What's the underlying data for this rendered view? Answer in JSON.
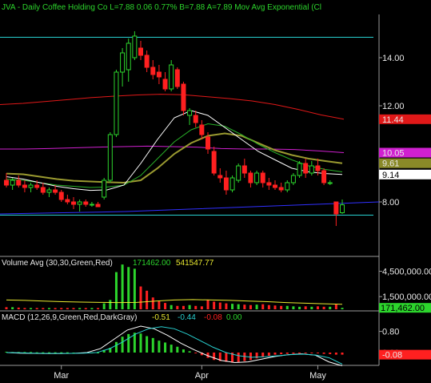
{
  "header": {
    "text": "JVA - Daily  Coffee Holding Co  L=7.88  0.06  0.77%  B=7.88  A=7.89  Mov Avg Exponential (Cl"
  },
  "colors": {
    "background": "#000000",
    "up_candle": "#2cd42c",
    "down_candle": "#ff2020",
    "header_text": "#2cd42c",
    "axis_text": "#e8e8e8",
    "bollinger_bands": "#28d0d0",
    "ma_long_red": "#e01818",
    "ma_magenta": "#d020d0",
    "ma_olive": "#9a9a30",
    "ma_green": "#28b028",
    "ma_white": "#ffffff",
    "blue_line": "#3030ff",
    "volume_avg": "#e8e830",
    "macd_line": "#ffffff",
    "macd_signal": "#28d0d0"
  },
  "chart_data": [
    {
      "type": "candlestick",
      "panel": "price",
      "x": [
        "2/15",
        "2/16",
        "2/17",
        "2/21",
        "2/22",
        "2/23",
        "2/24",
        "2/27",
        "2/28",
        "3/1",
        "3/2",
        "3/3",
        "3/6",
        "3/7",
        "3/8",
        "3/9",
        "3/10",
        "3/13",
        "3/14",
        "3/15",
        "3/16",
        "3/17",
        "3/20",
        "3/21",
        "3/22",
        "3/23",
        "3/24",
        "3/27",
        "3/28",
        "3/29",
        "3/30",
        "3/31",
        "4/3",
        "4/4",
        "4/5",
        "4/6",
        "4/7",
        "4/10",
        "4/11",
        "4/12",
        "4/13",
        "4/17",
        "4/18",
        "4/19",
        "4/20",
        "4/21",
        "4/24",
        "4/25",
        "4/26",
        "4/27",
        "4/28",
        "5/1",
        "5/2",
        "5/3",
        "5/4",
        "5/5"
      ],
      "x_tick_labels": [
        "Mar",
        "Apr",
        "May"
      ],
      "y_tick_labels": [
        "14.00",
        "12.00",
        "10.00",
        "8.00"
      ],
      "y_axis_side": "right",
      "ylim": [
        6.5,
        15.2
      ],
      "last_values": {
        "ma_red": "11.44",
        "ma_magenta": "10.05",
        "ma_olive": "9.61",
        "ma_white": "9.14"
      },
      "series": [
        {
          "kind": "ohlc",
          "values": [
            [
              8.9,
              9.2,
              8.6,
              8.7
            ],
            [
              8.7,
              9.0,
              8.5,
              8.9
            ],
            [
              8.9,
              9.1,
              8.6,
              8.7
            ],
            [
              8.7,
              8.9,
              8.4,
              8.6
            ],
            [
              8.6,
              8.8,
              8.4,
              8.7
            ],
            [
              8.7,
              8.9,
              8.5,
              8.6
            ],
            [
              8.6,
              8.8,
              8.3,
              8.4
            ],
            [
              8.4,
              8.6,
              8.2,
              8.5
            ],
            [
              8.5,
              8.7,
              8.3,
              8.4
            ],
            [
              8.4,
              8.5,
              8.0,
              8.1
            ],
            [
              8.1,
              8.3,
              7.9,
              8.0
            ],
            [
              8.0,
              8.2,
              7.7,
              7.9
            ],
            [
              7.9,
              8.1,
              7.6,
              8.0
            ],
            [
              8.0,
              8.1,
              7.8,
              7.9
            ],
            [
              7.9,
              8.0,
              7.8,
              7.9
            ],
            [
              7.9,
              8.0,
              7.8,
              7.8
            ],
            [
              8.2,
              9.0,
              8.1,
              8.9
            ],
            [
              8.9,
              10.9,
              8.8,
              10.8
            ],
            [
              10.8,
              13.5,
              10.7,
              13.4
            ],
            [
              13.4,
              14.4,
              12.8,
              14.2
            ],
            [
              13.5,
              14.8,
              13.0,
              14.6
            ],
            [
              14.0,
              15.1,
              13.9,
              14.9
            ],
            [
              14.4,
              14.7,
              13.9,
              14.1
            ],
            [
              14.1,
              14.3,
              13.4,
              13.6
            ],
            [
              13.6,
              13.9,
              13.1,
              13.3
            ],
            [
              13.4,
              13.7,
              12.9,
              13.2
            ],
            [
              13.1,
              13.4,
              12.6,
              12.7
            ],
            [
              12.7,
              13.9,
              12.6,
              13.7
            ],
            [
              13.5,
              13.6,
              12.7,
              12.8
            ],
            [
              12.9,
              13.0,
              11.6,
              11.8
            ],
            [
              11.6,
              11.9,
              11.2,
              11.8
            ],
            [
              11.6,
              11.8,
              11.1,
              11.3
            ],
            [
              11.2,
              11.4,
              10.6,
              10.8
            ],
            [
              10.7,
              10.9,
              10.0,
              10.2
            ],
            [
              10.1,
              10.3,
              9.1,
              9.2
            ],
            [
              9.1,
              9.4,
              8.8,
              9.0
            ],
            [
              9.0,
              9.3,
              8.3,
              8.5
            ],
            [
              8.5,
              9.1,
              8.4,
              9.0
            ],
            [
              8.9,
              9.6,
              8.8,
              9.5
            ],
            [
              9.5,
              9.8,
              9.0,
              9.2
            ],
            [
              9.2,
              9.3,
              8.6,
              8.8
            ],
            [
              8.8,
              9.3,
              8.7,
              9.2
            ],
            [
              9.2,
              9.3,
              8.6,
              8.8
            ],
            [
              8.8,
              9.0,
              8.5,
              8.7
            ],
            [
              8.7,
              8.9,
              8.5,
              8.6
            ],
            [
              8.6,
              8.8,
              8.4,
              8.5
            ],
            [
              8.5,
              8.9,
              8.4,
              8.8
            ],
            [
              8.8,
              9.2,
              8.7,
              9.1
            ],
            [
              9.1,
              9.7,
              9.0,
              9.6
            ],
            [
              9.6,
              9.8,
              9.0,
              9.2
            ],
            [
              9.2,
              9.7,
              9.1,
              9.5
            ],
            [
              9.5,
              9.8,
              9.1,
              9.3
            ],
            [
              9.3,
              9.4,
              8.7,
              8.8
            ],
            [
              8.8,
              8.9,
              8.7,
              8.8
            ],
            [
              8.0,
              8.0,
              7.0,
              7.5
            ],
            [
              7.55,
              8.1,
              7.5,
              7.88
            ]
          ]
        },
        {
          "kind": "line",
          "name": "bb_upper",
          "values": [
            14.85,
            14.85
          ]
        },
        {
          "kind": "line",
          "name": "bb_lower",
          "values": [
            7.45,
            7.45
          ]
        },
        {
          "kind": "line",
          "name": "ma_red",
          "values": [
            12.05,
            12.1,
            12.18,
            12.26,
            12.34,
            12.4,
            12.45,
            12.48,
            12.46,
            12.38,
            12.3,
            12.2,
            12.05,
            11.85,
            11.62,
            11.44
          ]
        },
        {
          "kind": "line",
          "name": "ma_magenta",
          "values": [
            10.2,
            10.2,
            10.22,
            10.25,
            10.28,
            10.3,
            10.32,
            10.3,
            10.28,
            10.22,
            10.2,
            10.2,
            10.18,
            10.12,
            10.05
          ]
        },
        {
          "kind": "line",
          "name": "ma_olive",
          "values": [
            9.18,
            9.15,
            9.05,
            8.95,
            8.88,
            8.85,
            8.82,
            8.8,
            8.9,
            9.4,
            10.0,
            10.45,
            10.75,
            10.85,
            10.75,
            10.45,
            10.15,
            9.95,
            9.8,
            9.7,
            9.61
          ]
        },
        {
          "kind": "line",
          "name": "ma_green",
          "values": [
            8.95,
            8.9,
            8.8,
            8.7,
            8.65,
            8.6,
            8.62,
            8.7,
            9.1,
            9.8,
            10.5,
            11.0,
            11.25,
            11.15,
            10.8,
            10.4,
            10.05,
            9.75,
            9.5,
            9.35,
            9.25
          ]
        },
        {
          "kind": "line",
          "name": "ma_white",
          "values": [
            9.05,
            8.95,
            8.8,
            8.65,
            8.55,
            8.48,
            8.5,
            8.7,
            9.6,
            10.6,
            11.5,
            11.8,
            11.6,
            11.1,
            10.6,
            10.1,
            9.75,
            9.4,
            9.25,
            9.18,
            9.14
          ]
        },
        {
          "kind": "line",
          "name": "blue_line",
          "values": [
            7.5,
            7.55,
            7.6,
            7.7,
            7.8,
            7.9,
            8.0
          ]
        }
      ]
    },
    {
      "type": "bar",
      "panel": "volume",
      "title": "Volume Avg (30,30,Green,Red)",
      "values_text": [
        "171462.00",
        "541547.77"
      ],
      "y_tick_labels": [
        "4,500,000.00",
        "1,500,000.00"
      ],
      "last_value": "171,462.00",
      "ylim": [
        0,
        5500000
      ],
      "values": [
        250000,
        250000,
        200000,
        150000,
        150000,
        150000,
        150000,
        150000,
        150000,
        150000,
        150000,
        150000,
        150000,
        150000,
        150000,
        150000,
        700000,
        1100000,
        4400000,
        5300000,
        5000000,
        4800000,
        2700000,
        2200000,
        1400000,
        950000,
        750000,
        500000,
        400000,
        400000,
        500000,
        400000,
        350000,
        1100000,
        900000,
        800000,
        700000,
        650000,
        600000,
        550000,
        500000,
        550000,
        600000,
        500000,
        450000,
        400000,
        400000,
        350000,
        300000,
        350000,
        300000,
        350000,
        300000,
        300000,
        600000,
        171462
      ],
      "ma_values": [
        1100000,
        1050000,
        980000,
        900000,
        850000,
        820000,
        800000,
        820000,
        980000,
        1100000,
        1150000,
        1100000,
        1050000,
        980000,
        900000,
        800000,
        720000,
        650000,
        600000
      ]
    },
    {
      "type": "bar",
      "panel": "macd",
      "title": "MACD (12,26,9,Green,Red,DarkGray)",
      "values_text": [
        "-0.51",
        "-0.44",
        "-0.08",
        "0.00"
      ],
      "y_tick_labels": [
        "0.80",
        "0.00"
      ],
      "last_value": "-0.08",
      "ylim": [
        -0.55,
        1.15
      ],
      "histogram": [
        0.03,
        0.02,
        0.02,
        0.02,
        0.02,
        0.01,
        0.01,
        0.01,
        0.01,
        0.01,
        0.01,
        0.0,
        0.0,
        0.0,
        0.0,
        0.0,
        0.1,
        0.18,
        0.4,
        0.6,
        0.7,
        0.75,
        0.72,
        0.62,
        0.55,
        0.45,
        0.38,
        0.3,
        0.22,
        0.12,
        0.05,
        -0.03,
        -0.1,
        -0.2,
        -0.28,
        -0.32,
        -0.35,
        -0.38,
        -0.36,
        -0.32,
        -0.28,
        -0.22,
        -0.18,
        -0.12,
        -0.08,
        -0.06,
        -0.05,
        -0.04,
        -0.03,
        -0.02,
        -0.02,
        -0.03,
        -0.05,
        -0.06,
        -0.08,
        -0.08
      ],
      "macd_line": [
        0.0,
        -0.02,
        -0.03,
        -0.04,
        -0.04,
        -0.03,
        0.0,
        0.15,
        0.5,
        0.85,
        1.0,
        0.9,
        0.65,
        0.35,
        0.1,
        -0.12,
        -0.3,
        -0.38,
        -0.35,
        -0.25,
        -0.15,
        -0.08,
        -0.05,
        -0.1,
        -0.35,
        -0.5
      ],
      "signal_line": [
        0.0,
        -0.01,
        -0.02,
        -0.03,
        -0.03,
        -0.03,
        -0.02,
        0.0,
        0.15,
        0.4,
        0.7,
        0.9,
        0.98,
        0.9,
        0.7,
        0.45,
        0.2,
        0.0,
        -0.12,
        -0.18,
        -0.16,
        -0.12,
        -0.08,
        -0.06,
        -0.1,
        -0.2,
        -0.44
      ]
    }
  ]
}
